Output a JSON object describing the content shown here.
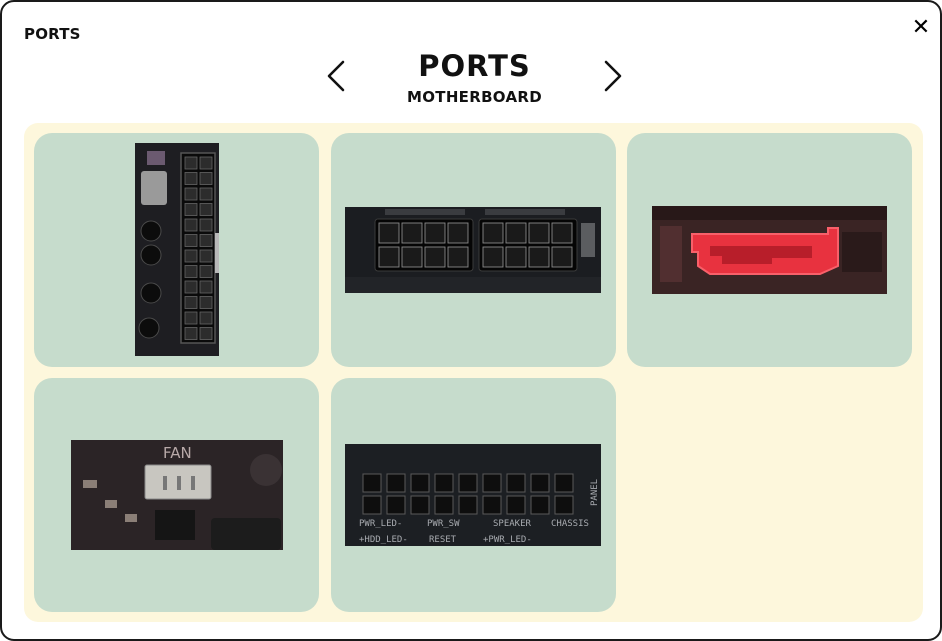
{
  "window": {
    "title": "PORTS",
    "close_glyph": "✕"
  },
  "header": {
    "title": "PORTS",
    "subtitle": "MOTHERBOARD"
  },
  "nav": {
    "prev_icon": "chevron-left-icon",
    "next_icon": "chevron-right-icon"
  },
  "colors": {
    "panel_bg": "#fdf7dc",
    "card_bg": "#c6dccc",
    "sata_red": "#e8323f"
  },
  "ports": [
    {
      "name": "24-pin ATX power connector"
    },
    {
      "name": "8-pin CPU power connectors"
    },
    {
      "name": "SATA port"
    },
    {
      "name": "Fan header",
      "labels": [
        "FAN"
      ]
    },
    {
      "name": "Front panel header",
      "labels": [
        "PWR_LED-",
        "PWR_SW",
        "SPEAKER",
        "CHASSIS",
        "+HDD_LED-",
        "RESET",
        "+PWR_LED-",
        "PANEL"
      ]
    }
  ]
}
